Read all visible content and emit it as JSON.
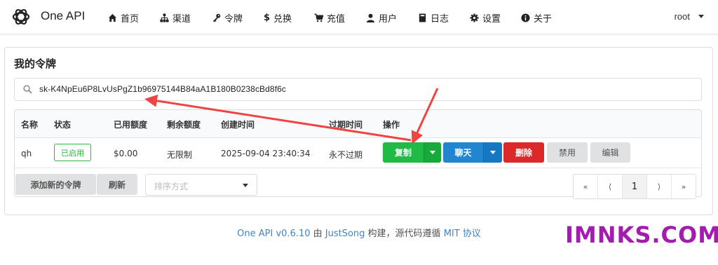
{
  "header": {
    "brand": "One API",
    "nav": [
      {
        "label": "首页",
        "icon": "home-icon"
      },
      {
        "label": "渠道",
        "icon": "sitemap-icon"
      },
      {
        "label": "令牌",
        "icon": "key-icon"
      },
      {
        "label": "兑换",
        "icon": "dollar-icon"
      },
      {
        "label": "充值",
        "icon": "cart-icon"
      },
      {
        "label": "用户",
        "icon": "user-icon"
      },
      {
        "label": "日志",
        "icon": "book-icon"
      },
      {
        "label": "设置",
        "icon": "gear-icon"
      },
      {
        "label": "关于",
        "icon": "info-icon"
      }
    ],
    "user": "root"
  },
  "page": {
    "title": "我的令牌",
    "search_value": "sk-K4NpEu6P8LvUsPgZ1b96975144B84aA1B180B0238cBd8f6c"
  },
  "table": {
    "columns": [
      "名称",
      "状态",
      "已用额度",
      "剩余额度",
      "创建时间",
      "过期时间",
      "操作"
    ],
    "rows": [
      {
        "name": "qh",
        "status": "已启用",
        "used": "$0.00",
        "remaining": "无限制",
        "created": "2025-09-04 23:40:34",
        "expires": "永不过期"
      }
    ],
    "actions": {
      "copy": "复制",
      "chat": "聊天",
      "delete": "删除",
      "disable": "禁用",
      "edit": "编辑"
    }
  },
  "toolbar": {
    "add": "添加新的令牌",
    "refresh": "刷新",
    "sort_placeholder": "排序方式"
  },
  "pagination": {
    "first": "«",
    "prev": "⟨",
    "current": "1",
    "next": "⟩",
    "last": "»"
  },
  "footer": {
    "app": "One API v0.6.10",
    "by": " 由 ",
    "author": "JustSong",
    "built": " 构建，源代码遵循 ",
    "license": "MIT 协议"
  },
  "watermark": "IMNKS.COM",
  "colors": {
    "green": "#21ba45",
    "blue": "#2185d0",
    "red": "#db2828",
    "arrow": "#ef4444",
    "watermark": "#a21caf"
  }
}
